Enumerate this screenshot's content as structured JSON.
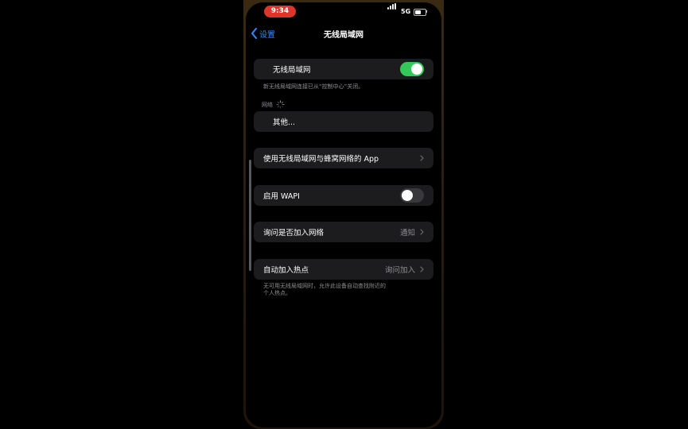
{
  "status_bar": {
    "time": "9:34",
    "network": "5G"
  },
  "nav": {
    "back_label": "设置",
    "title": "无线局域网"
  },
  "wifi": {
    "label": "无线局域网",
    "enabled": true,
    "footnote": "新无线局域网连接已从“控制中心”关闭。"
  },
  "networks": {
    "header": "网络",
    "other_label": "其他..."
  },
  "apps_row": {
    "label": "使用无线局域网与蜂窝网络的 App"
  },
  "wapi_row": {
    "label": "启用 WAPI",
    "enabled": false
  },
  "ask_join_row": {
    "label": "询问是否加入网络",
    "value": "通知"
  },
  "hotspot_row": {
    "label": "自动加入热点",
    "value": "询问加入",
    "footnote_line1": "无可用无线局域网时，允许此设备自动查找附近的",
    "footnote_line2": "个人热点。"
  },
  "colors": {
    "accent": "#2f8bff",
    "toggle_on": "#34c759",
    "toggle_off": "#39393d",
    "cell_bg": "#1c1c1e",
    "secondary_text": "#8e8e93",
    "time_pill": "#e0332b"
  },
  "icons": {
    "back": "chevron-left-icon",
    "disclosure": "chevron-right-icon",
    "loading": "spinner-icon",
    "signal": "signal-bars-icon",
    "battery": "battery-icon"
  }
}
